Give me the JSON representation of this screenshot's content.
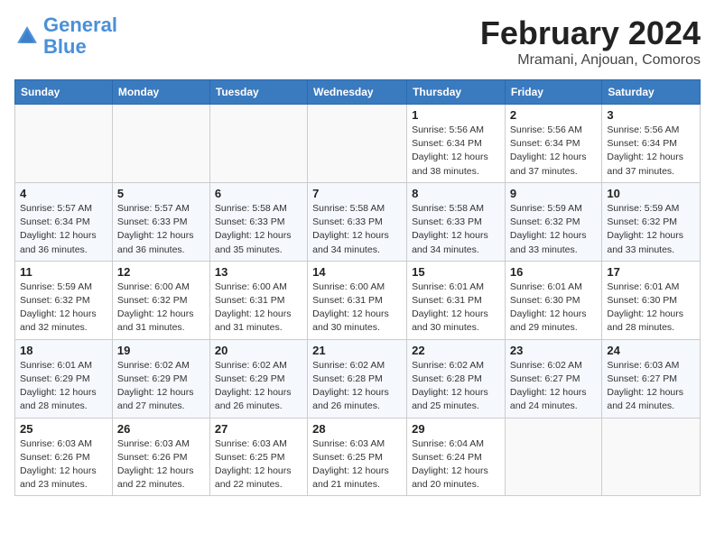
{
  "logo": {
    "line1": "General",
    "line2": "Blue"
  },
  "title": "February 2024",
  "subtitle": "Mramani, Anjouan, Comoros",
  "days_of_week": [
    "Sunday",
    "Monday",
    "Tuesday",
    "Wednesday",
    "Thursday",
    "Friday",
    "Saturday"
  ],
  "weeks": [
    [
      {
        "num": "",
        "info": ""
      },
      {
        "num": "",
        "info": ""
      },
      {
        "num": "",
        "info": ""
      },
      {
        "num": "",
        "info": ""
      },
      {
        "num": "1",
        "info": "Sunrise: 5:56 AM\nSunset: 6:34 PM\nDaylight: 12 hours\nand 38 minutes."
      },
      {
        "num": "2",
        "info": "Sunrise: 5:56 AM\nSunset: 6:34 PM\nDaylight: 12 hours\nand 37 minutes."
      },
      {
        "num": "3",
        "info": "Sunrise: 5:56 AM\nSunset: 6:34 PM\nDaylight: 12 hours\nand 37 minutes."
      }
    ],
    [
      {
        "num": "4",
        "info": "Sunrise: 5:57 AM\nSunset: 6:34 PM\nDaylight: 12 hours\nand 36 minutes."
      },
      {
        "num": "5",
        "info": "Sunrise: 5:57 AM\nSunset: 6:33 PM\nDaylight: 12 hours\nand 36 minutes."
      },
      {
        "num": "6",
        "info": "Sunrise: 5:58 AM\nSunset: 6:33 PM\nDaylight: 12 hours\nand 35 minutes."
      },
      {
        "num": "7",
        "info": "Sunrise: 5:58 AM\nSunset: 6:33 PM\nDaylight: 12 hours\nand 34 minutes."
      },
      {
        "num": "8",
        "info": "Sunrise: 5:58 AM\nSunset: 6:33 PM\nDaylight: 12 hours\nand 34 minutes."
      },
      {
        "num": "9",
        "info": "Sunrise: 5:59 AM\nSunset: 6:32 PM\nDaylight: 12 hours\nand 33 minutes."
      },
      {
        "num": "10",
        "info": "Sunrise: 5:59 AM\nSunset: 6:32 PM\nDaylight: 12 hours\nand 33 minutes."
      }
    ],
    [
      {
        "num": "11",
        "info": "Sunrise: 5:59 AM\nSunset: 6:32 PM\nDaylight: 12 hours\nand 32 minutes."
      },
      {
        "num": "12",
        "info": "Sunrise: 6:00 AM\nSunset: 6:32 PM\nDaylight: 12 hours\nand 31 minutes."
      },
      {
        "num": "13",
        "info": "Sunrise: 6:00 AM\nSunset: 6:31 PM\nDaylight: 12 hours\nand 31 minutes."
      },
      {
        "num": "14",
        "info": "Sunrise: 6:00 AM\nSunset: 6:31 PM\nDaylight: 12 hours\nand 30 minutes."
      },
      {
        "num": "15",
        "info": "Sunrise: 6:01 AM\nSunset: 6:31 PM\nDaylight: 12 hours\nand 30 minutes."
      },
      {
        "num": "16",
        "info": "Sunrise: 6:01 AM\nSunset: 6:30 PM\nDaylight: 12 hours\nand 29 minutes."
      },
      {
        "num": "17",
        "info": "Sunrise: 6:01 AM\nSunset: 6:30 PM\nDaylight: 12 hours\nand 28 minutes."
      }
    ],
    [
      {
        "num": "18",
        "info": "Sunrise: 6:01 AM\nSunset: 6:29 PM\nDaylight: 12 hours\nand 28 minutes."
      },
      {
        "num": "19",
        "info": "Sunrise: 6:02 AM\nSunset: 6:29 PM\nDaylight: 12 hours\nand 27 minutes."
      },
      {
        "num": "20",
        "info": "Sunrise: 6:02 AM\nSunset: 6:29 PM\nDaylight: 12 hours\nand 26 minutes."
      },
      {
        "num": "21",
        "info": "Sunrise: 6:02 AM\nSunset: 6:28 PM\nDaylight: 12 hours\nand 26 minutes."
      },
      {
        "num": "22",
        "info": "Sunrise: 6:02 AM\nSunset: 6:28 PM\nDaylight: 12 hours\nand 25 minutes."
      },
      {
        "num": "23",
        "info": "Sunrise: 6:02 AM\nSunset: 6:27 PM\nDaylight: 12 hours\nand 24 minutes."
      },
      {
        "num": "24",
        "info": "Sunrise: 6:03 AM\nSunset: 6:27 PM\nDaylight: 12 hours\nand 24 minutes."
      }
    ],
    [
      {
        "num": "25",
        "info": "Sunrise: 6:03 AM\nSunset: 6:26 PM\nDaylight: 12 hours\nand 23 minutes."
      },
      {
        "num": "26",
        "info": "Sunrise: 6:03 AM\nSunset: 6:26 PM\nDaylight: 12 hours\nand 22 minutes."
      },
      {
        "num": "27",
        "info": "Sunrise: 6:03 AM\nSunset: 6:25 PM\nDaylight: 12 hours\nand 22 minutes."
      },
      {
        "num": "28",
        "info": "Sunrise: 6:03 AM\nSunset: 6:25 PM\nDaylight: 12 hours\nand 21 minutes."
      },
      {
        "num": "29",
        "info": "Sunrise: 6:04 AM\nSunset: 6:24 PM\nDaylight: 12 hours\nand 20 minutes."
      },
      {
        "num": "",
        "info": ""
      },
      {
        "num": "",
        "info": ""
      }
    ]
  ]
}
